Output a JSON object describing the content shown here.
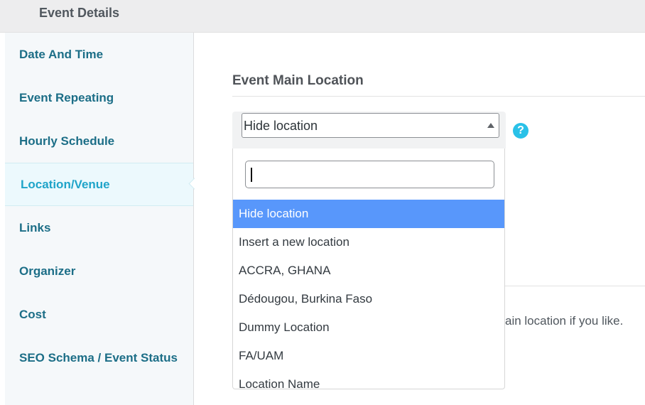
{
  "header": {
    "title": "Event Details"
  },
  "sidebar": {
    "items": [
      {
        "label": "Date And Time"
      },
      {
        "label": "Event Repeating"
      },
      {
        "label": "Hourly Schedule"
      },
      {
        "label": "Location/Venue",
        "active": true
      },
      {
        "label": "Links"
      },
      {
        "label": "Organizer"
      },
      {
        "label": "Cost"
      },
      {
        "label": "SEO Schema / Event Status"
      }
    ]
  },
  "main": {
    "section_title": "Event Main Location",
    "select": {
      "value": "Hide location"
    },
    "help_icon": "question-circle-icon",
    "hint_text": "ain location if you like."
  },
  "dropdown": {
    "search_value": "",
    "options": [
      {
        "label": "Hide location",
        "highlighted": true
      },
      {
        "label": "Insert a new location"
      },
      {
        "label": "ACCRA, GHANA"
      },
      {
        "label": "Dédougou, Burkina Faso"
      },
      {
        "label": "Dummy Location"
      },
      {
        "label": "FA/UAM"
      },
      {
        "label": "Location Name"
      }
    ]
  },
  "colors": {
    "accent": "#1fa4c9",
    "link": "#1c6e87",
    "highlight": "#5897fb",
    "help": "#29c1e8"
  }
}
